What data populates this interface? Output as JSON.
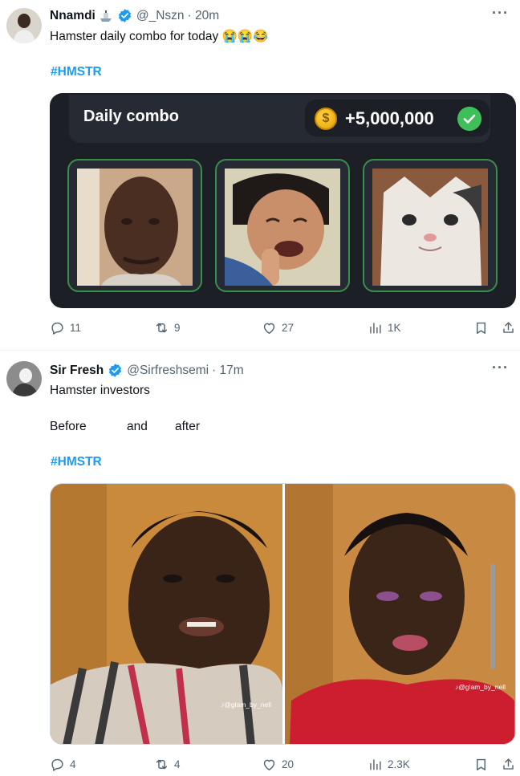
{
  "tweets": [
    {
      "name": "Nnamdi",
      "handle": "@_Nszn",
      "time": "· 20m",
      "text": "Hamster daily combo for today 😭😭😂",
      "hashtag": "#HMSTR",
      "combo": {
        "title": "Daily combo",
        "reward": "+5,000,000",
        "coin_symbol": "$"
      },
      "actions": {
        "replies": "11",
        "reposts": "9",
        "likes": "27",
        "views": "1K"
      }
    },
    {
      "name": "Sir Fresh",
      "handle": "@Sirfreshsemi",
      "time": "· 17m",
      "text": "Hamster investors",
      "line2_before": "Before",
      "line2_and": "and",
      "line2_after": "after",
      "hashtag": "#HMSTR",
      "watermark_left": "♪@glam_by_nell",
      "watermark_right": "♪@glam_by_nell",
      "actions": {
        "replies": "4",
        "reposts": "4",
        "likes": "20",
        "views": "2.3K"
      }
    }
  ],
  "colors": {
    "link": "#1d9bf0",
    "verified": "#1d9bf0",
    "muted": "#536471"
  }
}
